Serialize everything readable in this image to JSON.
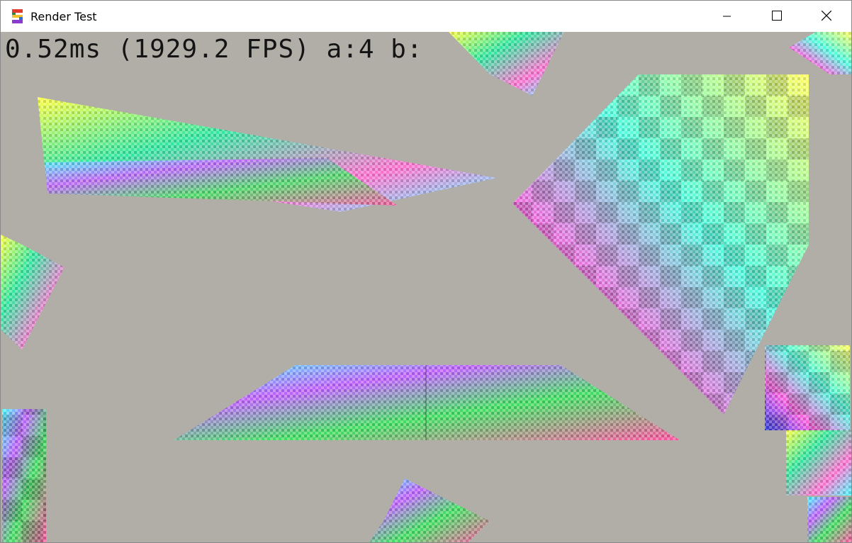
{
  "window": {
    "title": "Render Test",
    "icon": "render-app-icon",
    "controls": [
      "minimize-icon",
      "maximize-icon",
      "close-icon"
    ]
  },
  "overlay": {
    "stats": "0.52ms (1929.2 FPS) a:4 b:"
  },
  "colors": {
    "background": "#b0aea7",
    "text": "#141414"
  }
}
